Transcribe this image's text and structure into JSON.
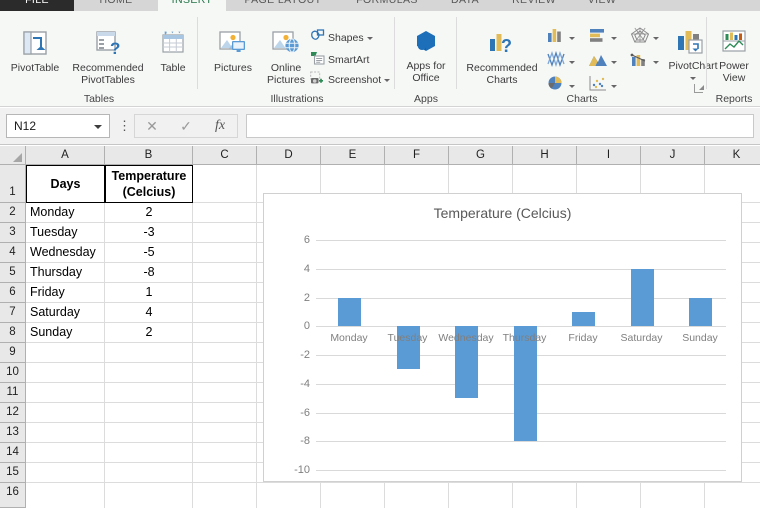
{
  "ribbon": {
    "tabs": [
      {
        "label": "FILE",
        "state": "file"
      },
      {
        "label": "HOME",
        "state": "normal"
      },
      {
        "label": "INSERT",
        "state": "active"
      },
      {
        "label": "PAGE LAYOUT",
        "state": "normal"
      },
      {
        "label": "FORMULAS",
        "state": "normal"
      },
      {
        "label": "DATA",
        "state": "normal"
      },
      {
        "label": "REVIEW",
        "state": "normal"
      },
      {
        "label": "VIEW",
        "state": "normal"
      }
    ],
    "groups": [
      {
        "name": "Tables"
      },
      {
        "name": "Illustrations"
      },
      {
        "name": "Apps"
      },
      {
        "name": "Charts"
      },
      {
        "name": "Reports"
      }
    ],
    "tables": {
      "pivot_table": "PivotTable",
      "recommended_pivot_line1": "Recommended",
      "recommended_pivot_line2": "PivotTables",
      "table": "Table"
    },
    "illustrations": {
      "pictures": "Pictures",
      "online_pictures_line1": "Online",
      "online_pictures_line2": "Pictures",
      "shapes": "Shapes",
      "smartart": "SmartArt",
      "screenshot": "Screenshot"
    },
    "apps": {
      "apps_for_office_line1": "Apps for",
      "apps_for_office_line2": "Office"
    },
    "charts": {
      "recommended_line1": "Recommended",
      "recommended_line2": "Charts",
      "pivotchart": "PivotChart"
    },
    "reports": {
      "power_view_line1": "Power",
      "power_view_line2": "View"
    }
  },
  "formula_bar": {
    "name_box_value": "N12",
    "cancel_icon": "✕",
    "enter_icon": "✓",
    "function_icon": "fx",
    "formula_value": ""
  },
  "grid": {
    "columns": [
      "A",
      "B",
      "C",
      "D",
      "E",
      "F",
      "G",
      "H",
      "I",
      "J",
      "K"
    ],
    "rows": [
      "1",
      "2",
      "3",
      "4",
      "5",
      "6",
      "7",
      "8",
      "9",
      "10",
      "11",
      "12",
      "13",
      "14",
      "15",
      "16"
    ],
    "header": {
      "a1": "Days",
      "b1_line1": "Temperature",
      "b1_line2": "(Celcius)"
    },
    "data_rows": [
      {
        "day": "Monday",
        "temp": "2"
      },
      {
        "day": "Tuesday",
        "temp": "-3"
      },
      {
        "day": "Wednesday",
        "temp": "-5"
      },
      {
        "day": "Thursday",
        "temp": "-8"
      },
      {
        "day": "Friday",
        "temp": "1"
      },
      {
        "day": "Saturday",
        "temp": "4"
      },
      {
        "day": "Sunday",
        "temp": "2"
      }
    ]
  },
  "chart_data": {
    "type": "bar",
    "title": "Temperature (Celcius)",
    "xlabel": "",
    "ylabel": "",
    "categories": [
      "Monday",
      "Tuesday",
      "Wednesday",
      "Thursday",
      "Friday",
      "Saturday",
      "Sunday"
    ],
    "values": [
      2,
      -3,
      -5,
      -8,
      1,
      4,
      2
    ],
    "series": [
      {
        "name": "Temperature (Celcius)",
        "values": [
          2,
          -3,
          -5,
          -8,
          1,
          4,
          2
        ],
        "color": "#5B9BD5"
      }
    ],
    "ylim": [
      -10,
      6
    ],
    "yticks": [
      6,
      4,
      2,
      0,
      -2,
      -4,
      -6,
      -8,
      -10
    ],
    "ytick_labels": [
      "6",
      "4",
      "2",
      "0",
      "-2",
      "-4",
      "-6",
      "-8",
      "-10"
    ],
    "grid": true,
    "legend": false,
    "bar_color": "#5B9BD5"
  }
}
